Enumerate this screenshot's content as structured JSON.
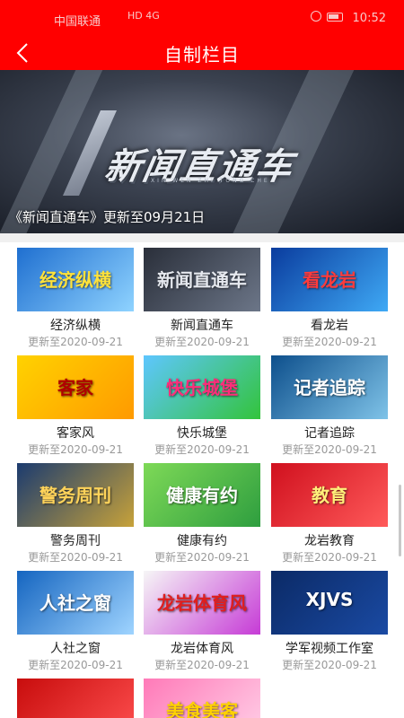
{
  "status_bar": {
    "carrier": "中国联通",
    "signal": "HD 4G",
    "time": "10:52"
  },
  "app_bar": {
    "title": "自制栏目",
    "back_icon": "chevron-left-icon"
  },
  "banner": {
    "logo_text": "新闻直通车",
    "logo_sub": "XIN WEN ZHI TONG CHE",
    "caption": "《新闻直通车》更新至09月21日"
  },
  "programs": [
    {
      "name": "经济纵横",
      "date": "更新至2020-09-21",
      "thumb_text": "经济纵横",
      "colors": [
        "#1f6fd0",
        "#8fd3ff"
      ],
      "text_color": "#ffe23a"
    },
    {
      "name": "新闻直通车",
      "date": "更新至2020-09-21",
      "thumb_text": "新闻直通车",
      "colors": [
        "#2a2f3a",
        "#6c7688"
      ],
      "text_color": "#e6e9ef"
    },
    {
      "name": "看龙岩",
      "date": "更新至2020-09-21",
      "thumb_text": "看龙岩",
      "colors": [
        "#0a3c9e",
        "#3fa9f5"
      ],
      "text_color": "#ff3b3b"
    },
    {
      "name": "客家风",
      "date": "更新至2020-09-21",
      "thumb_text": "客家",
      "colors": [
        "#ffd200",
        "#ff9a00"
      ],
      "text_color": "#b00000"
    },
    {
      "name": "快乐城堡",
      "date": "更新至2020-09-21",
      "thumb_text": "快乐城堡",
      "colors": [
        "#5ec6ff",
        "#33c43b"
      ],
      "text_color": "#ff2d7a"
    },
    {
      "name": "记者追踪",
      "date": "更新至2020-09-21",
      "thumb_text": "记者追踪",
      "colors": [
        "#0d4f8c",
        "#7fc3e8"
      ],
      "text_color": "#ffffff"
    },
    {
      "name": "警务周刊",
      "date": "更新至2020-09-21",
      "thumb_text": "警务周刊",
      "colors": [
        "#1b3b6f",
        "#c7a23a"
      ],
      "text_color": "#ffd35a"
    },
    {
      "name": "健康有约",
      "date": "更新至2020-09-21",
      "thumb_text": "健康有约",
      "colors": [
        "#7ed957",
        "#2e9e3f"
      ],
      "text_color": "#ffffff"
    },
    {
      "name": "龙岩教育",
      "date": "更新至2020-09-21",
      "thumb_text": "教育",
      "colors": [
        "#d0101e",
        "#ff5a5a"
      ],
      "text_color": "#ffef7a"
    },
    {
      "name": "人社之窗",
      "date": "更新至2020-09-21",
      "thumb_text": "人社之窗",
      "colors": [
        "#1565c0",
        "#9fd4ff"
      ],
      "text_color": "#ffffff"
    },
    {
      "name": "龙岩体育风",
      "date": "更新至2020-09-21",
      "thumb_text": "龙岩体育风",
      "colors": [
        "#f6f6f6",
        "#c63bd6"
      ],
      "text_color": "#e01e1e"
    },
    {
      "name": "学军视频工作室",
      "date": "更新至2020-09-21",
      "thumb_text": "XJVS",
      "colors": [
        "#0b2a66",
        "#1a4aa3"
      ],
      "text_color": "#ffffff"
    },
    {
      "name": "",
      "date": "",
      "thumb_text": "",
      "colors": [
        "#c80d0d",
        "#ff5050"
      ],
      "text_color": "#ffd200"
    },
    {
      "name": "",
      "date": "",
      "thumb_text": "美食美客",
      "colors": [
        "#ff7ab8",
        "#ffd1e8"
      ],
      "text_color": "#ffd200"
    }
  ]
}
